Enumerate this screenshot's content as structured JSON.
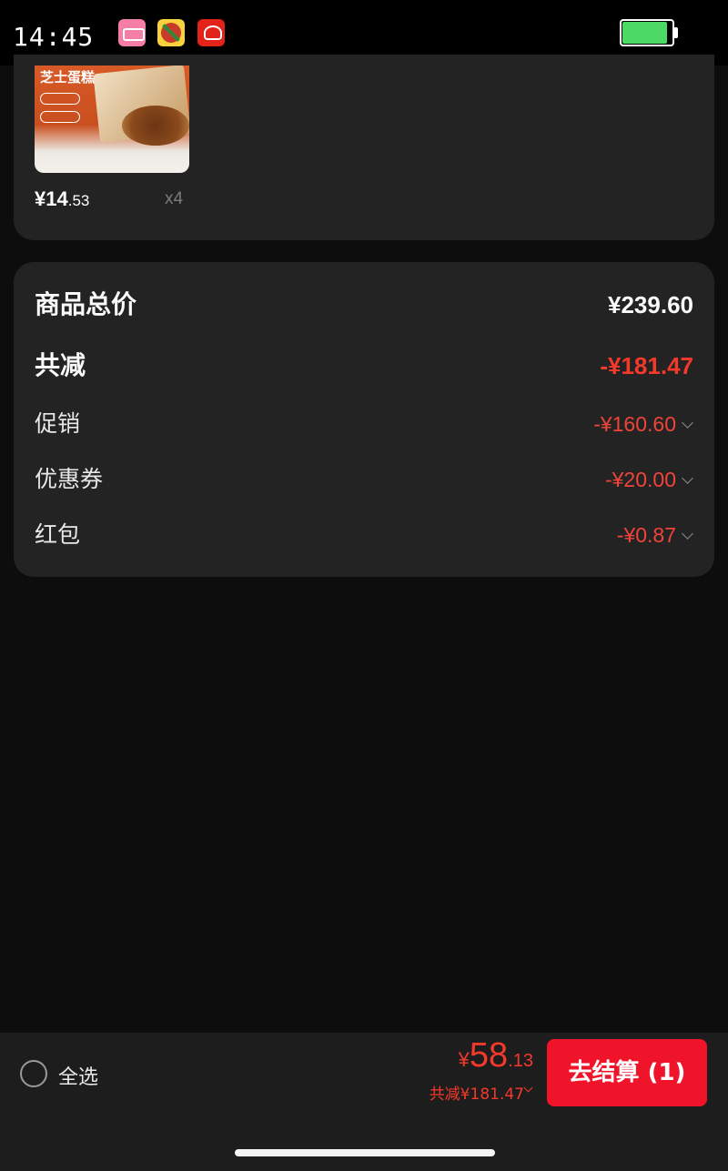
{
  "status_bar": {
    "time": "14:45",
    "apps": [
      "bilibili-icon",
      "du-icon",
      "jd-icon"
    ],
    "battery_level": 0.9
  },
  "product": {
    "thumb_title": "芝士蛋糕",
    "thumb_tags": [
      "",
      ""
    ],
    "price_main": "¥14",
    "price_cents": ".53",
    "quantity": "x4"
  },
  "summary": {
    "total_label": "商品总价",
    "total_value": "¥239.60",
    "reduce_label": "共减",
    "reduce_value": "-¥181.47",
    "promo_label": "促销",
    "promo_value": "-¥160.60",
    "coupon_label": "优惠券",
    "coupon_value": "-¥20.00",
    "redpacket_label": "红包",
    "redpacket_value": "-¥0.87"
  },
  "bottom": {
    "select_all_label": "全选",
    "price_yen": "¥",
    "price_int": "58",
    "price_dec": ".13",
    "reduce_text": "共减¥181.47",
    "checkout_label": "去结算 (1)"
  },
  "colors": {
    "accent_red": "#f4392b",
    "checkout_red": "#f0142a",
    "card_bg": "#232323",
    "page_bg": "#0d0d0d"
  }
}
